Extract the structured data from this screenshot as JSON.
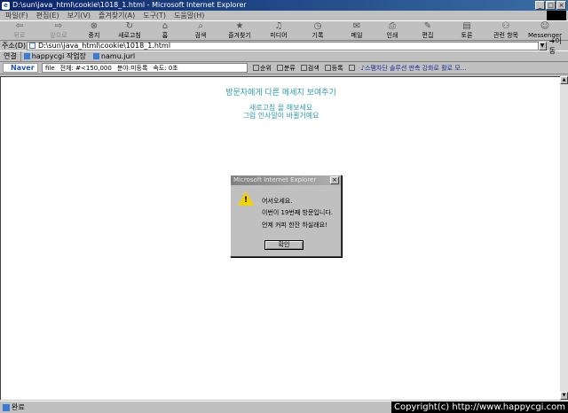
{
  "window": {
    "title": "D:\\sun\\java_html\\cookie\\1018_1.html - Microsoft Internet Explorer"
  },
  "menu": [
    "파일(F)",
    "편집(E)",
    "보기(V)",
    "즐겨찾기(A)",
    "도구(T)",
    "도움말(H)"
  ],
  "toolbar": {
    "back": "뒤로",
    "forward": "앞으로",
    "stop": "중지",
    "refresh": "새로고침",
    "home": "홈",
    "search": "검색",
    "favorites": "즐겨찾기",
    "media": "미디어",
    "history": "기록",
    "mail": "메일",
    "print": "인쇄",
    "edit": "편집",
    "discuss": "토론",
    "related": "관련 항목",
    "messenger": "Messenger"
  },
  "address": {
    "label": "주소(D)",
    "value": "D:\\sun\\java_html\\cookie\\1018_1.html",
    "go": "이동"
  },
  "links": {
    "label": "연결",
    "items": [
      "happycgi 작업장",
      "namu.jurl"
    ]
  },
  "searchbar": {
    "logo": "Naver",
    "query": "file",
    "info_total": "전체: #<150,000",
    "info_area": "분야:미등록",
    "info_speed": "속도: 0초",
    "buttons": [
      "순위",
      "분류",
      "검색",
      "등록"
    ],
    "promo": "스팸차단 솔루션 판촉 강화로 활로 모..."
  },
  "page": {
    "heading": "방문자에게 다른 메세지 보여주기",
    "line1": "새로고침 을 해보세요",
    "line2": "그럼 인사말이 바뀔거예요"
  },
  "dialog": {
    "title": "Microsoft Internet Explorer",
    "line1": "어서오세요.",
    "line2": "이번이 19번째 방문입니다.",
    "line3": "언제 커피 한잔 하실래요!",
    "ok": "확인"
  },
  "status": {
    "text": "완료",
    "copyright": "Copyright(c) http://www.happycgi.com"
  }
}
